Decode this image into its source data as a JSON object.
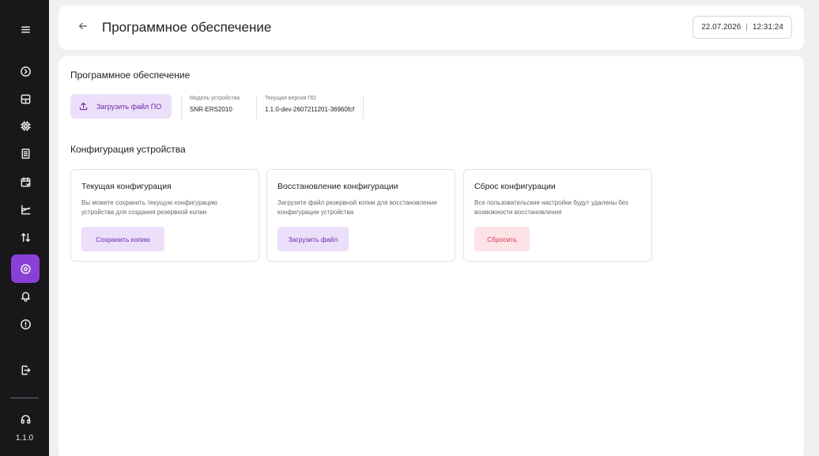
{
  "sidebar": {
    "items": [
      {
        "name": "menu-icon"
      },
      {
        "name": "circle-chevron-right-icon"
      },
      {
        "name": "dashboard-icon"
      },
      {
        "name": "chip-icon"
      },
      {
        "name": "document-icon"
      },
      {
        "name": "calendar-icon"
      },
      {
        "name": "chart-icon"
      },
      {
        "name": "transfer-icon"
      },
      {
        "name": "settings-icon",
        "active": true
      },
      {
        "name": "bell-icon"
      },
      {
        "name": "info-icon"
      },
      {
        "name": "logout-icon"
      },
      {
        "name": "headset-icon"
      }
    ],
    "version": "1.1.0"
  },
  "header": {
    "title": "Программное обеспечение",
    "date": "22.07.2026",
    "separator": "|",
    "time": "12:31:24"
  },
  "software": {
    "section_title": "Программное обеспечение",
    "upload_label": "Загрузить файл ПО",
    "model_label": "Модель устройства",
    "model_value": "SNR-ERS2010",
    "version_label": "Текущая версия ПО",
    "version_value": "1.1.0-dev-2607211201-36960fcf"
  },
  "config": {
    "section_title": "Конфигурация устройства",
    "cards": [
      {
        "title": "Текущая конфигурация",
        "desc": "Вы можете сохранить текущую конфигурацию устройства для создания резервной копии",
        "button": "Сохранить копию"
      },
      {
        "title": "Восстановление конфигурации",
        "desc": "Загрузите файл резервной копии для восстановления конфигурации устройства",
        "button": "Загрузить файл"
      },
      {
        "title": "Сброс конфигурации",
        "desc": "Все пользовательские настройки будут удалены без возможности восстановления",
        "button": "Сбросить"
      }
    ]
  },
  "colors": {
    "sidebar_bg": "#18181b",
    "accent": "#8a3fd6",
    "accent_soft": "#ecdff9",
    "danger": "#d43a4f",
    "danger_soft": "#fde2e6"
  }
}
